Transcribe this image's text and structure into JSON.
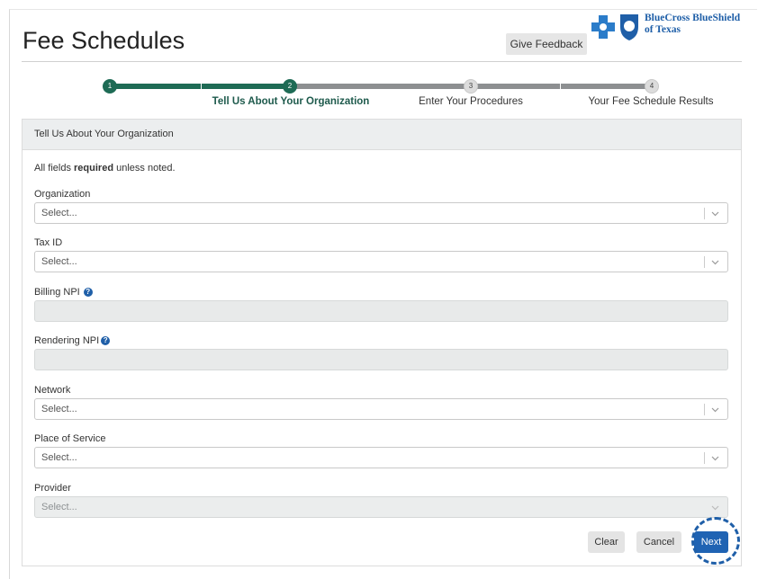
{
  "header": {
    "title": "Fee Schedules",
    "feedback_label": "Give Feedback",
    "logo_line1": "BlueCross BlueShield",
    "logo_line2": "of Texas"
  },
  "stepper": {
    "steps": [
      {
        "number": "1",
        "label": "",
        "state": "done"
      },
      {
        "number": "2",
        "label": "Tell Us About Your Organization",
        "state": "active"
      },
      {
        "number": "3",
        "label": "Enter Your Procedures",
        "state": "todo"
      },
      {
        "number": "4",
        "label": "Your Fee Schedule Results",
        "state": "todo"
      }
    ]
  },
  "panel": {
    "heading": "Tell Us About Your Organization",
    "note_prefix": "All fields ",
    "note_bold": "required",
    "note_suffix": " unless noted.",
    "fields": {
      "organization": {
        "label": "Organization",
        "placeholder": "Select..."
      },
      "tax_id": {
        "label": "Tax ID",
        "placeholder": "Select..."
      },
      "billing_npi": {
        "label": "Billing NPI",
        "help_icon": "question-circle-icon"
      },
      "rendering_npi": {
        "label": "Rendering NPI",
        "help_icon": "question-circle-icon"
      },
      "network": {
        "label": "Network",
        "placeholder": "Select..."
      },
      "place_of_service": {
        "label": "Place of Service",
        "placeholder": "Select..."
      },
      "provider": {
        "label": "Provider",
        "placeholder": "Select..."
      }
    },
    "buttons": {
      "clear": "Clear",
      "cancel": "Cancel",
      "next": "Next"
    }
  },
  "colors": {
    "brand_blue": "#1f5fa8",
    "step_green": "#1e6b55",
    "next_button": "#1f63b3"
  }
}
